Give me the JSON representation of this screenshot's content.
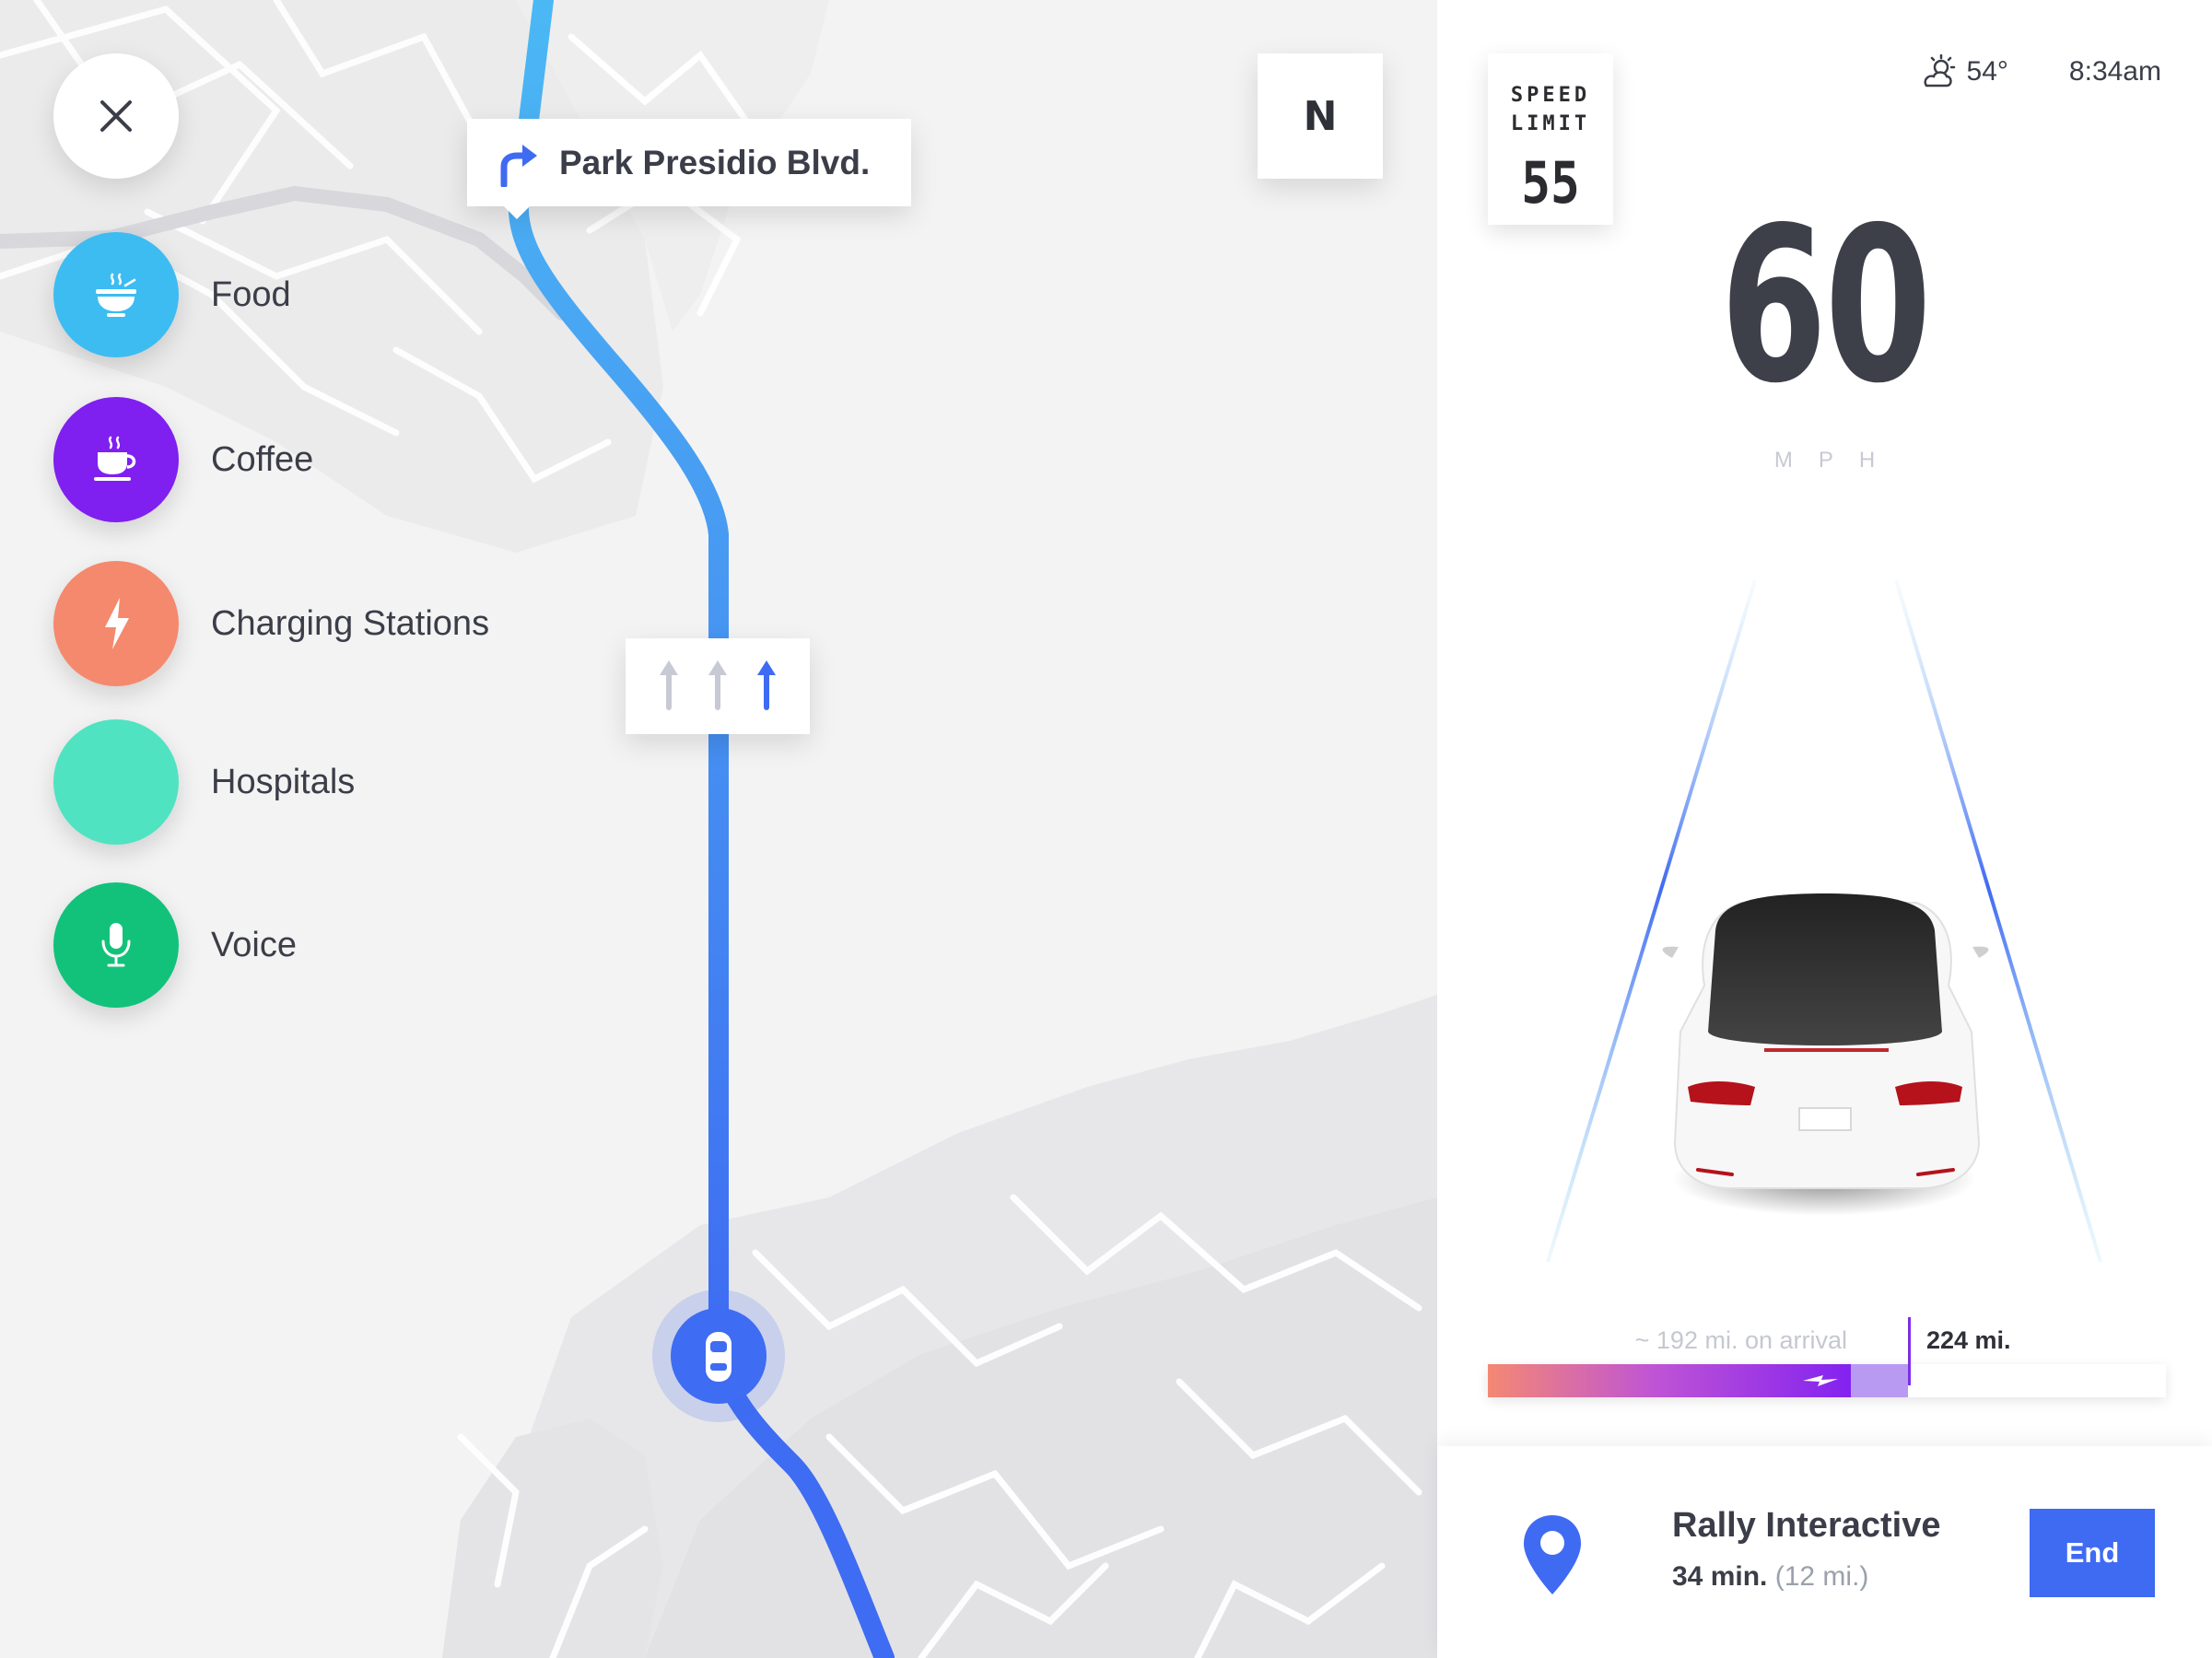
{
  "map": {
    "compass_heading": "N",
    "next_turn": {
      "direction": "right",
      "street": "Park Presidio Blvd."
    },
    "lane_guidance": {
      "lanes": 3,
      "active_lane": 3
    },
    "close_icon": "close-icon"
  },
  "poi_menu": {
    "items": [
      {
        "label": "Food",
        "icon": "food-bowl-icon",
        "color": "#3dbcf2"
      },
      {
        "label": "Coffee",
        "icon": "coffee-cup-icon",
        "color": "#7f1ff0"
      },
      {
        "label": "Charging Stations",
        "icon": "lightning-bolt-icon",
        "color": "#f5896d"
      },
      {
        "label": "Hospitals",
        "icon": "",
        "color": "#50e3c2"
      },
      {
        "label": "Voice",
        "icon": "microphone-icon",
        "color": "#12c27b"
      }
    ]
  },
  "dashboard": {
    "speed_limit": {
      "line1": "SPEED",
      "line2": "LIMIT",
      "value": "55"
    },
    "weather": {
      "icon": "partly-cloudy-icon",
      "temperature": "54°"
    },
    "time": "8:34am",
    "speed": {
      "value": "60",
      "unit": "MPH"
    },
    "range": {
      "arrival_label": "~ 192 mi. on arrival",
      "total_label": "224 mi.",
      "arrival_fraction": 0.535,
      "total_fraction": 0.62
    },
    "destination": {
      "name": "Rally Interactive",
      "eta": "34 min.",
      "distance": "(12 mi.)",
      "end_label": "End"
    }
  },
  "colors": {
    "route_start": "#4bb8f4",
    "route_end": "#3e6cf2",
    "accent": "#3f6af2",
    "range_start": "#f48873",
    "range_end": "#8322f0"
  }
}
